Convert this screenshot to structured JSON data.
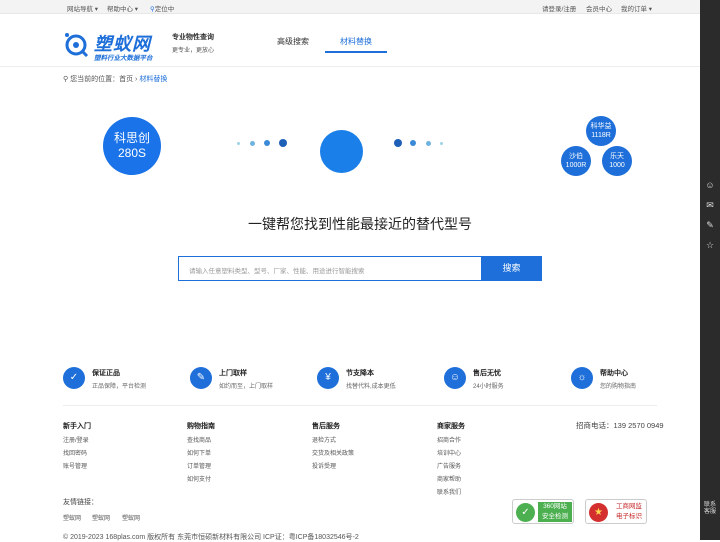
{
  "topbar": {
    "site_nav": "网站导航",
    "help_center": "帮助中心",
    "location": "定位中",
    "login": "请登录/注册",
    "member": "会员中心",
    "orders": "我的订单"
  },
  "header": {
    "logo_text": "塑蚁网",
    "logo_sub": "塑料行业大数据平台",
    "slogan_title": "专业物性查询",
    "slogan_sub": "更专业，更放心",
    "tabs": [
      {
        "label": "高级搜索"
      },
      {
        "label": "材料替换"
      }
    ]
  },
  "breadcrumb": {
    "prefix": "您当前的位置：",
    "home": "首页",
    "current": "材料替换"
  },
  "hero": {
    "source": {
      "brand": "科思创",
      "grade": "280S"
    },
    "results": [
      {
        "brand": "科华益",
        "grade": "1118R"
      },
      {
        "brand": "沙伯",
        "grade": "1000R"
      },
      {
        "brand": "乐天",
        "grade": "1000"
      }
    ]
  },
  "headline": "一键帮您找到性能最接近的替代型号",
  "search": {
    "placeholder": "请输入任意塑料类型、型号、厂家、性能、用途进行智能搜索",
    "button": "搜索"
  },
  "features": [
    {
      "title": "保证正品",
      "desc": "正品保障，平台检测"
    },
    {
      "title": "上门取样",
      "desc": "如约而至，上门取样"
    },
    {
      "title": "节支降本",
      "desc": "找替代料,成本更低"
    },
    {
      "title": "售后无忧",
      "desc": "24小时服务"
    },
    {
      "title": "帮助中心",
      "desc": "您的购物指南"
    }
  ],
  "footer": {
    "columns": [
      {
        "title": "新手入门",
        "items": [
          "注册/登录",
          "找回密码",
          "账号管理"
        ]
      },
      {
        "title": "购物指南",
        "items": [
          "查找商品",
          "如何下单",
          "订单管理",
          "如何支付"
        ]
      },
      {
        "title": "售后服务",
        "items": [
          "退检方式",
          "交货及相关政策",
          "投诉受理"
        ]
      },
      {
        "title": "商家服务",
        "items": [
          "招商合作",
          "培训中心",
          "广告服务",
          "商家帮助",
          "联系我们"
        ]
      }
    ],
    "phone": "招商电话：139 2570 0949",
    "friend_title": "友情链接：",
    "friend_links": [
      "塑蚁网",
      "塑蚁网",
      "塑蚁网"
    ],
    "badges": [
      {
        "line1": "360网站",
        "line2": "安全检测"
      },
      {
        "line1": "工商网监",
        "line2": "电子标识"
      }
    ],
    "copyright": "© 2019-2023 168plas.com 版权所有 东莞市恒硕新材料有限公司 ICP证：粤ICP备18032546号-2"
  },
  "right_sidebar": {
    "bottom_label": "联系客服"
  },
  "colors": {
    "accent": "#1e6fd9"
  }
}
